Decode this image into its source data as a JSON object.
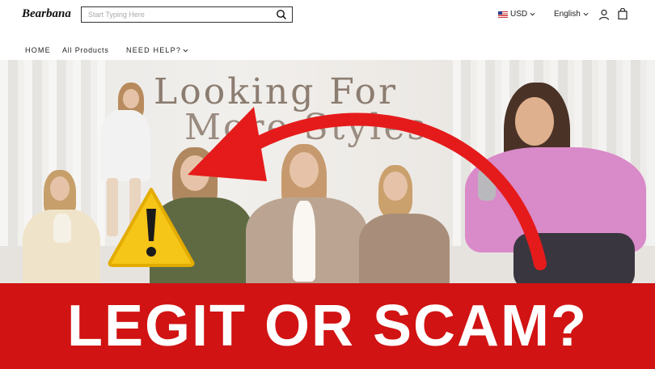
{
  "header": {
    "logo": "Bearbana",
    "search_placeholder": "Start Typing Here",
    "currency": "USD",
    "language": "English"
  },
  "nav": {
    "items": [
      "HOME",
      "All Products",
      "NEED HELP?"
    ]
  },
  "hero": {
    "title_line1": "Looking For",
    "title_line2": "More Styles"
  },
  "overlay": {
    "banner_text": "LEGIT OR SCAM?",
    "banner_color": "#d11313",
    "arrow_color": "#e51b1b",
    "warning_color": "#f5c518"
  },
  "icons": [
    "search-icon",
    "us-flag-icon",
    "chevron-down-icon",
    "user-icon",
    "shopping-bag-icon",
    "warning-icon",
    "arrow-icon"
  ]
}
